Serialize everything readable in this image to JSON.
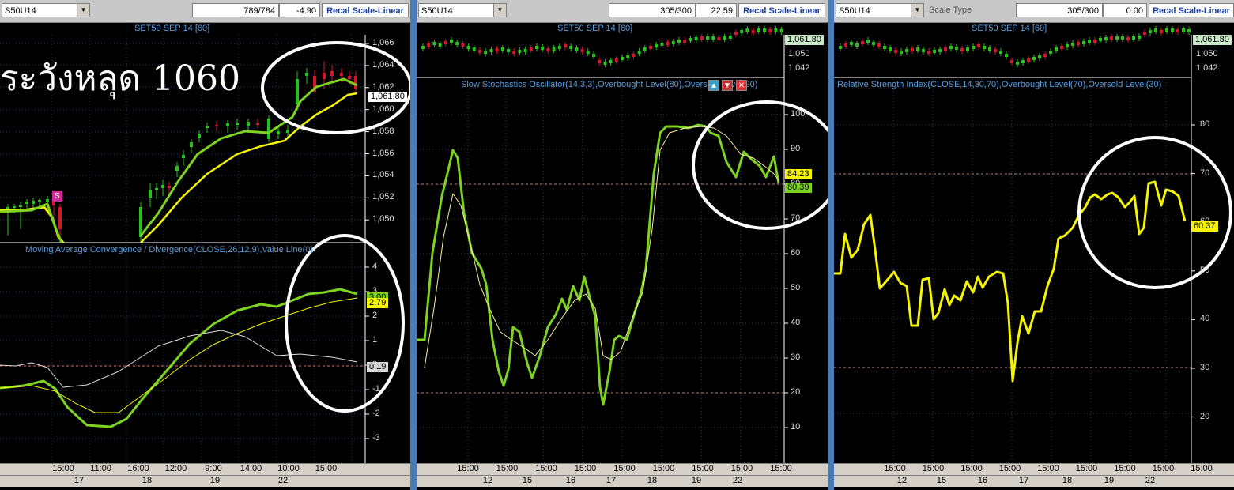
{
  "colors": {
    "green": "#7ed321",
    "yellow": "#f5f500",
    "white": "#dddddd",
    "up": "#27c21b",
    "down": "#d6162a",
    "grid": "#2a3f55",
    "ref": "#c87878",
    "accent": "#4a7bb5"
  },
  "panels": [
    {
      "symbol": "S50U14",
      "bars": "789/784",
      "change": "-4.90",
      "recal": "Recal Scale-Linear",
      "title": "SET50 SEP 14  [60]",
      "annotation": "ระวังหลุด 1060",
      "price_ticks": [
        "1,066",
        "1,064",
        "1,062",
        "1,060",
        "1,058",
        "1,056",
        "1,054",
        "1,052",
        "1,050"
      ],
      "price_tag": "1,061.80",
      "sig_marker": "S",
      "ind_title": "Moving Average Convergence / Divergence(CLOSE,26,12,9),Value Line(0)",
      "ind_ticks": [
        "4",
        "3",
        "2",
        "1",
        "0",
        "-1",
        "-2",
        "-3"
      ],
      "ind_tags": [
        "3.00",
        "2.79",
        "0.19"
      ],
      "times": [
        "15:00",
        "11:00",
        "16:00",
        "12:00",
        "9:00",
        "14:00",
        "10:00",
        "15:00"
      ],
      "days": [
        "17",
        "18",
        "19",
        "22"
      ]
    },
    {
      "symbol": "S50U14",
      "bars": "305/300",
      "change": "22.59",
      "recal": "Recal Scale-Linear",
      "title": "SET50 SEP 14  [60]",
      "price_ticks": [
        "1,061.80",
        "1,050",
        "1,042"
      ],
      "ind_title": "Slow Stochastics Oscillator(14,3,3),Overbought Level(80),Oversold Level(20)",
      "ind_ticks": [
        "100",
        "90",
        "80",
        "70",
        "60",
        "50",
        "40",
        "30",
        "20",
        "10"
      ],
      "ind_tags": [
        "84.23",
        "80.39"
      ],
      "times": [
        "15:00",
        "15:00",
        "15:00",
        "15:00",
        "15:00",
        "15:00",
        "15:00",
        "15:00",
        "15:00"
      ],
      "days": [
        "12",
        "15",
        "16",
        "17",
        "18",
        "19",
        "22"
      ]
    },
    {
      "symbol": "S50U14",
      "scale_type": "Scale Type",
      "bars": "305/300",
      "change": "0.00",
      "recal": "Recal Scale-Linear",
      "title": "SET50 SEP 14  [60]",
      "price_ticks": [
        "1,061.80",
        "1,050",
        "1,042"
      ],
      "ind_title": "Relative Strength Index(CLOSE,14,30,70),Overbought Level(70),Oversold Level(30)",
      "ind_ticks": [
        "80",
        "70",
        "60",
        "50",
        "40",
        "30",
        "20"
      ],
      "ind_tags": [
        "60.37"
      ],
      "times": [
        "15:00",
        "15:00",
        "15:00",
        "15:00",
        "15:00",
        "15:00",
        "15:00",
        "15:00",
        "15:00"
      ],
      "days": [
        "12",
        "15",
        "16",
        "17",
        "18",
        "19",
        "22"
      ]
    }
  ]
}
